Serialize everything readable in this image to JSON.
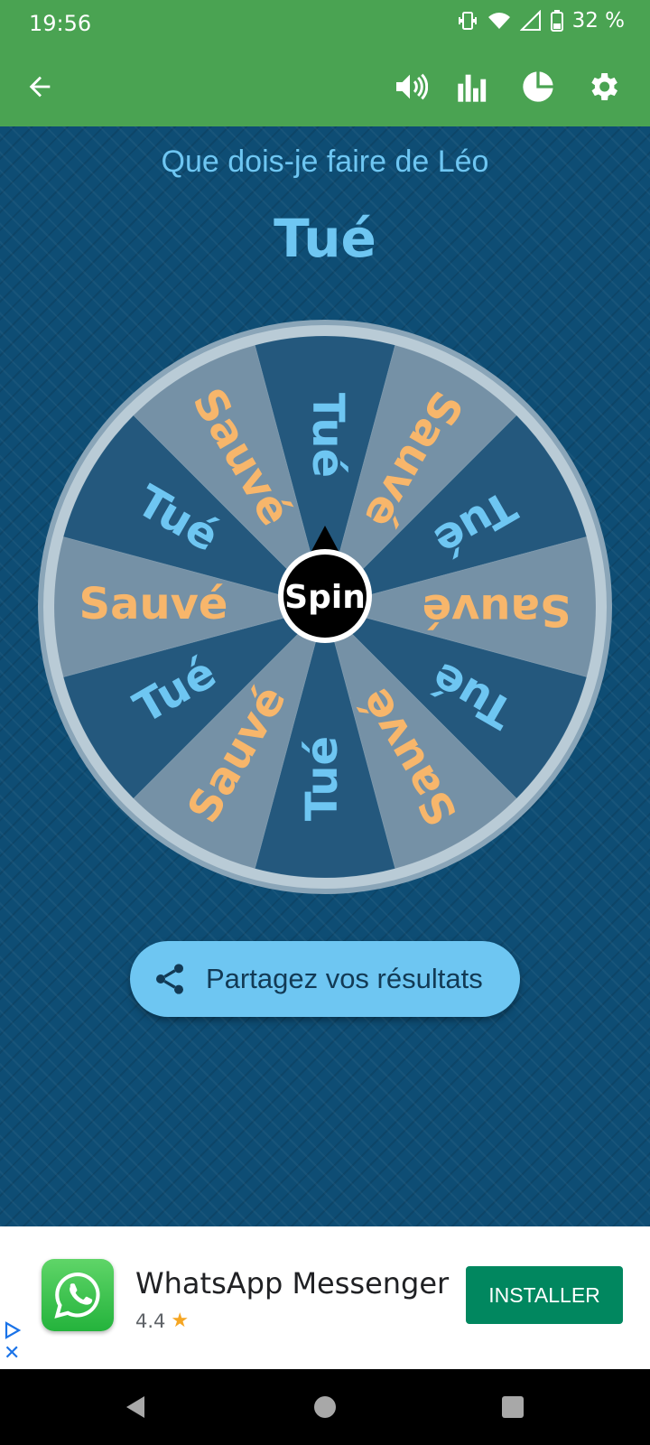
{
  "status_bar": {
    "time": "19:56",
    "battery": "32 %",
    "icons": [
      "vibrate-icon",
      "wifi-icon",
      "signal-icon",
      "battery-icon"
    ]
  },
  "app_bar": {
    "back_icon": "arrow-left-icon",
    "actions": [
      "volume-icon",
      "stats-icon",
      "pie-chart-icon",
      "gear-icon"
    ]
  },
  "main": {
    "question": "Que dois-je faire de Léo",
    "result": "Tué",
    "wheel": {
      "center_label": "Spin",
      "segments": [
        "Tué",
        "Sauvé",
        "Tué",
        "Sauvé",
        "Tué",
        "Sauvé",
        "Tué",
        "Sauvé",
        "Tué",
        "Sauvé",
        "Tué",
        "Sauvé"
      ]
    },
    "share_button": "Partagez vos résultats"
  },
  "ad": {
    "app_name": "WhatsApp Messenger",
    "rating": "4.4",
    "install_label": "INSTALLER"
  },
  "colors": {
    "app_bar": "#4aa352",
    "background": "#0e4d74",
    "accent_blue": "#6ec6f2",
    "accent_orange": "#f7b66b",
    "install_green": "#01875f"
  }
}
